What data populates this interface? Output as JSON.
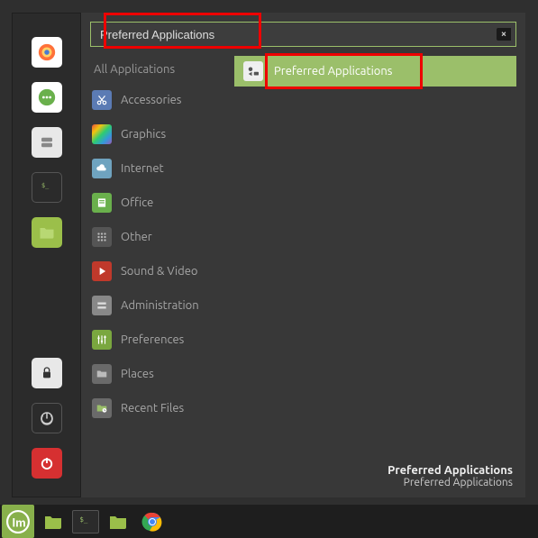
{
  "search": {
    "value": "Preferred Applications"
  },
  "favorites": [
    {
      "name": "firefox",
      "color": "#ff7139"
    },
    {
      "name": "chat",
      "color": "#6ab04c"
    },
    {
      "name": "software-manager",
      "color": "#e8e8e8"
    },
    {
      "name": "terminal",
      "color": "#2b2b2b"
    },
    {
      "name": "files",
      "color": "#9bbf4a"
    }
  ],
  "sys_favorites": [
    {
      "name": "lock",
      "color": "#e8e8e8"
    },
    {
      "name": "logout",
      "color": "#2b2b2b"
    },
    {
      "name": "shutdown",
      "color": "#d63031"
    }
  ],
  "categories": {
    "all": "All Applications",
    "items": [
      {
        "label": "Accessories",
        "icon": "scissors",
        "bg": "#5b7bb4"
      },
      {
        "label": "Graphics",
        "icon": "rainbow",
        "bg": "#000"
      },
      {
        "label": "Internet",
        "icon": "cloud",
        "bg": "#6fa3bf"
      },
      {
        "label": "Office",
        "icon": "book",
        "bg": "#6ab04c"
      },
      {
        "label": "Other",
        "icon": "grid",
        "bg": "#555"
      },
      {
        "label": "Sound & Video",
        "icon": "play",
        "bg": "#c0392b"
      },
      {
        "label": "Administration",
        "icon": "admin",
        "bg": "#888"
      },
      {
        "label": "Preferences",
        "icon": "prefs",
        "bg": "#7aa73f"
      },
      {
        "label": "Places",
        "icon": "folder",
        "bg": "#6a6a6a"
      },
      {
        "label": "Recent Files",
        "icon": "recent",
        "bg": "#6a6a6a"
      }
    ]
  },
  "results": [
    {
      "label": "Preferred Applications"
    }
  ],
  "description": {
    "title": "Preferred Applications",
    "subtitle": "Preferred Applications"
  },
  "taskbar": [
    {
      "name": "mint-menu"
    },
    {
      "name": "files"
    },
    {
      "name": "terminal"
    },
    {
      "name": "files2"
    },
    {
      "name": "chrome"
    }
  ]
}
